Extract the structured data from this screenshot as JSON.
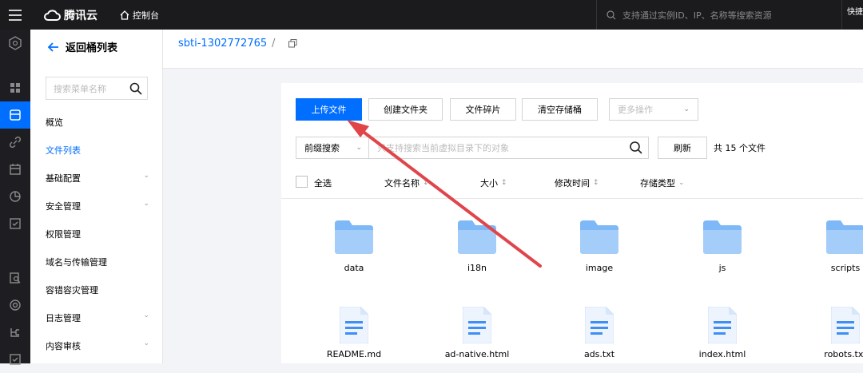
{
  "topbar": {
    "brand": "腾讯云",
    "console_label": "控制台",
    "search_placeholder": "支持通过实例ID、IP、名称等搜索资源",
    "quick_label": "快捷"
  },
  "sidebar": {
    "back_label": "返回桶列表",
    "search_placeholder": "搜索菜单名称",
    "items": [
      {
        "label": "概览",
        "chevron": false,
        "active": false
      },
      {
        "label": "文件列表",
        "chevron": false,
        "active": true
      },
      {
        "label": "基础配置",
        "chevron": true,
        "active": false
      },
      {
        "label": "安全管理",
        "chevron": true,
        "active": false
      },
      {
        "label": "权限管理",
        "chevron": false,
        "active": false
      },
      {
        "label": "域名与传输管理",
        "chevron": false,
        "active": false
      },
      {
        "label": "容错容灾管理",
        "chevron": false,
        "active": false
      },
      {
        "label": "日志管理",
        "chevron": true,
        "active": false
      },
      {
        "label": "内容审核",
        "chevron": true,
        "active": false
      }
    ]
  },
  "breadcrumb": {
    "bucket": "sbti-1302772765",
    "separator": "/"
  },
  "toolbar": {
    "upload": "上传文件",
    "create_folder": "创建文件夹",
    "fragments": "文件碎片",
    "clear_bucket": "清空存储桶",
    "more_actions": "更多操作"
  },
  "search": {
    "prefix": "前缀搜索",
    "placeholder": "只支持搜索当前虚拟目录下的对象",
    "refresh": "刷新",
    "count": "共 15 个文件"
  },
  "columns": {
    "select_all": "全选",
    "name": "文件名称",
    "size": "大小",
    "modified": "修改时间",
    "storage": "存储类型"
  },
  "folders": [
    "data",
    "i18n",
    "image",
    "js",
    "scripts"
  ],
  "files": [
    "README.md",
    "ad-native.html",
    "ads.txt",
    "index.html",
    "robots.txt"
  ],
  "colors": {
    "accent": "#006eff",
    "folder": "#7fb8f7",
    "annotation_arrow": "#e0454a"
  }
}
